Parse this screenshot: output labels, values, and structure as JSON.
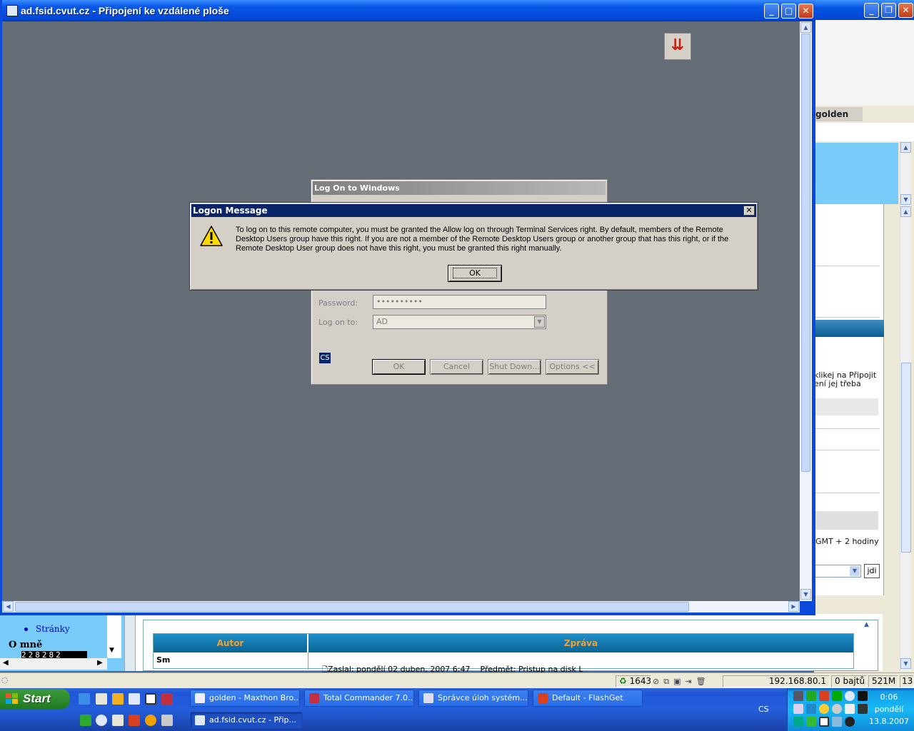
{
  "rd_window": {
    "title": "ad.fsid.cvut.cz - Připojení ke vzdálené ploše",
    "minimize": "_",
    "maximize": "□",
    "close": "✕"
  },
  "logon_dialog": {
    "title": "Log On to Windows",
    "password_label": "Password:",
    "password_value": "••••••••••",
    "logon_to_label": "Log on to:",
    "logon_to_value": "AD",
    "lang_indicator": "CS",
    "buttons": {
      "ok": "OK",
      "cancel": "Cancel",
      "shutdown": "Shut Down...",
      "options": "Options <<"
    }
  },
  "logon_message": {
    "title": "Logon Message",
    "close": "✕",
    "text": "To log on to this remote computer, you must be granted the Allow log on through Terminal Services right. By default, members of the Remote Desktop Users group have this right. If you are not a member of the Remote Desktop Users group or another group that has this right, or if the Remote Desktop User group does not have this right, you must be granted this right manually.",
    "ok": "OK",
    "icon": "warning-icon"
  },
  "browser": {
    "tab_label": "golden",
    "text_fragment_1": "klikej na Připojit",
    "text_fragment_2": "ení jej třeba",
    "timezone": "GMT + 2 hodiny",
    "go_button": "jdi",
    "sidebar_link": "Stránky",
    "sidebar_heading": "O mně",
    "counter": "228282",
    "table": {
      "headers": [
        "Autor",
        "Zpráva"
      ],
      "author": "Sm",
      "message": "Zaslal: pondělí 02 duben, 2007 6:47    Předmět: Pristup na disk L"
    }
  },
  "statusbar": {
    "count": "1643",
    "ip": "192.168.80.1",
    "bytes": "0 bajtů",
    "memory": "521M",
    "extra": "13"
  },
  "taskbar": {
    "start": "Start",
    "tasks_row1": [
      "golden - Maxthon Bro...",
      "Total Commander 7.0...",
      "Správce úloh systém...",
      "Default - FlashGet"
    ],
    "tasks_row2": [
      "ad.fsid.cvut.cz - Přip..."
    ],
    "lang": "CS",
    "clock_time": "0:06",
    "clock_day": "pondělí",
    "clock_date": "13.8.2007"
  },
  "colors": {
    "remote_bg": "#646c75",
    "xp_blue": "#0a49d9",
    "classic_title": "#0a246a"
  }
}
